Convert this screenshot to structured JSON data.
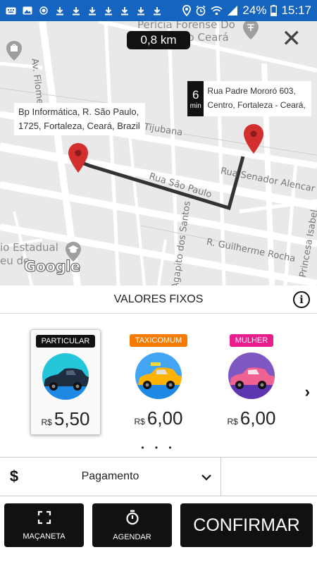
{
  "status_bar": {
    "battery": "24%",
    "time": "15:17",
    "icons": [
      "keyboard-icon",
      "image-icon",
      "record-icon",
      "download-icon",
      "download-icon",
      "download-icon",
      "download-icon",
      "download-icon",
      "download-icon",
      "download-icon",
      "location-icon",
      "alarm-icon",
      "wifi-icon",
      "signal-icon",
      "battery-icon"
    ]
  },
  "map": {
    "distance": "0,8 km",
    "origin_address": "Bp Informática, R. São Paulo, 1725, Fortaleza, Ceará, Brazil",
    "eta_value": "6",
    "eta_unit": "min",
    "destination_address": "Rua Padre Mororó 603, Centro, Fortaleza - Ceará,",
    "streets": {
      "filomeno": "Av. Filomeno Go",
      "tijubana": "Tijubana",
      "sao_paulo": "Rua São Paulo",
      "senador": "Rua Senador Alencar",
      "agapito": "Agapito dos Santos",
      "guilherme": "R. Guilherme Rocha",
      "princesa": "Princesa Isabel"
    },
    "pois": {
      "pericia": "Perícia Forense Do",
      "ceara": "Do Ceará",
      "estadual": "io Estadual",
      "museu": "eu de"
    },
    "attribution": "Google",
    "route_color": "#333333",
    "pin_color": "#d32f2f"
  },
  "fixed_values": {
    "title": "VALORES FIXOS"
  },
  "options": [
    {
      "label": "PARTICULAR",
      "label_color": "#111111",
      "currency": "R$",
      "price": "5,50",
      "selected": true,
      "car_color": "#1f2d40",
      "bg_color": "#26c6da"
    },
    {
      "label": "TAXICOMUM",
      "label_color": "#f57c00",
      "currency": "R$",
      "price": "6,00",
      "selected": false,
      "car_color": "#ffb300",
      "bg_color": "#42a5f5"
    },
    {
      "label": "MULHER",
      "label_color": "#e91e8c",
      "currency": "R$",
      "price": "6,00",
      "selected": false,
      "car_color": "#f06292",
      "bg_color": "#7e57c2"
    }
  ],
  "pagination": "• • •",
  "payment": {
    "icon": "$",
    "label": "Pagamento"
  },
  "buttons": {
    "macaneta": "MAÇANETA",
    "agendar": "AGENDAR",
    "confirmar": "CONFIRMAR"
  }
}
